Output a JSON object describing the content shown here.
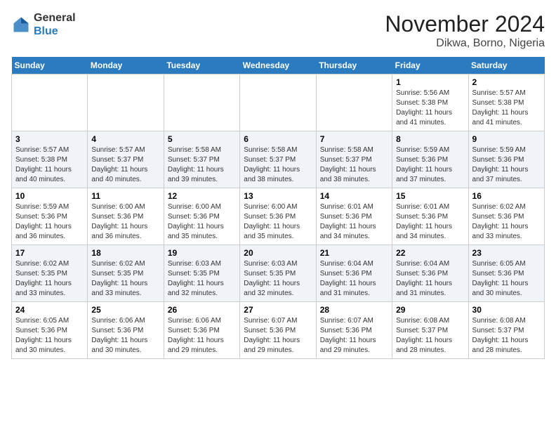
{
  "header": {
    "logo": {
      "general": "General",
      "blue": "Blue"
    },
    "title": "November 2024",
    "location": "Dikwa, Borno, Nigeria"
  },
  "calendar": {
    "days_of_week": [
      "Sunday",
      "Monday",
      "Tuesday",
      "Wednesday",
      "Thursday",
      "Friday",
      "Saturday"
    ],
    "weeks": [
      [
        {
          "day": "",
          "info": ""
        },
        {
          "day": "",
          "info": ""
        },
        {
          "day": "",
          "info": ""
        },
        {
          "day": "",
          "info": ""
        },
        {
          "day": "",
          "info": ""
        },
        {
          "day": "1",
          "info": "Sunrise: 5:56 AM\nSunset: 5:38 PM\nDaylight: 11 hours and 41 minutes."
        },
        {
          "day": "2",
          "info": "Sunrise: 5:57 AM\nSunset: 5:38 PM\nDaylight: 11 hours and 41 minutes."
        }
      ],
      [
        {
          "day": "3",
          "info": "Sunrise: 5:57 AM\nSunset: 5:38 PM\nDaylight: 11 hours and 40 minutes."
        },
        {
          "day": "4",
          "info": "Sunrise: 5:57 AM\nSunset: 5:37 PM\nDaylight: 11 hours and 40 minutes."
        },
        {
          "day": "5",
          "info": "Sunrise: 5:58 AM\nSunset: 5:37 PM\nDaylight: 11 hours and 39 minutes."
        },
        {
          "day": "6",
          "info": "Sunrise: 5:58 AM\nSunset: 5:37 PM\nDaylight: 11 hours and 38 minutes."
        },
        {
          "day": "7",
          "info": "Sunrise: 5:58 AM\nSunset: 5:37 PM\nDaylight: 11 hours and 38 minutes."
        },
        {
          "day": "8",
          "info": "Sunrise: 5:59 AM\nSunset: 5:36 PM\nDaylight: 11 hours and 37 minutes."
        },
        {
          "day": "9",
          "info": "Sunrise: 5:59 AM\nSunset: 5:36 PM\nDaylight: 11 hours and 37 minutes."
        }
      ],
      [
        {
          "day": "10",
          "info": "Sunrise: 5:59 AM\nSunset: 5:36 PM\nDaylight: 11 hours and 36 minutes."
        },
        {
          "day": "11",
          "info": "Sunrise: 6:00 AM\nSunset: 5:36 PM\nDaylight: 11 hours and 36 minutes."
        },
        {
          "day": "12",
          "info": "Sunrise: 6:00 AM\nSunset: 5:36 PM\nDaylight: 11 hours and 35 minutes."
        },
        {
          "day": "13",
          "info": "Sunrise: 6:00 AM\nSunset: 5:36 PM\nDaylight: 11 hours and 35 minutes."
        },
        {
          "day": "14",
          "info": "Sunrise: 6:01 AM\nSunset: 5:36 PM\nDaylight: 11 hours and 34 minutes."
        },
        {
          "day": "15",
          "info": "Sunrise: 6:01 AM\nSunset: 5:36 PM\nDaylight: 11 hours and 34 minutes."
        },
        {
          "day": "16",
          "info": "Sunrise: 6:02 AM\nSunset: 5:36 PM\nDaylight: 11 hours and 33 minutes."
        }
      ],
      [
        {
          "day": "17",
          "info": "Sunrise: 6:02 AM\nSunset: 5:35 PM\nDaylight: 11 hours and 33 minutes."
        },
        {
          "day": "18",
          "info": "Sunrise: 6:02 AM\nSunset: 5:35 PM\nDaylight: 11 hours and 33 minutes."
        },
        {
          "day": "19",
          "info": "Sunrise: 6:03 AM\nSunset: 5:35 PM\nDaylight: 11 hours and 32 minutes."
        },
        {
          "day": "20",
          "info": "Sunrise: 6:03 AM\nSunset: 5:35 PM\nDaylight: 11 hours and 32 minutes."
        },
        {
          "day": "21",
          "info": "Sunrise: 6:04 AM\nSunset: 5:36 PM\nDaylight: 11 hours and 31 minutes."
        },
        {
          "day": "22",
          "info": "Sunrise: 6:04 AM\nSunset: 5:36 PM\nDaylight: 11 hours and 31 minutes."
        },
        {
          "day": "23",
          "info": "Sunrise: 6:05 AM\nSunset: 5:36 PM\nDaylight: 11 hours and 30 minutes."
        }
      ],
      [
        {
          "day": "24",
          "info": "Sunrise: 6:05 AM\nSunset: 5:36 PM\nDaylight: 11 hours and 30 minutes."
        },
        {
          "day": "25",
          "info": "Sunrise: 6:06 AM\nSunset: 5:36 PM\nDaylight: 11 hours and 30 minutes."
        },
        {
          "day": "26",
          "info": "Sunrise: 6:06 AM\nSunset: 5:36 PM\nDaylight: 11 hours and 29 minutes."
        },
        {
          "day": "27",
          "info": "Sunrise: 6:07 AM\nSunset: 5:36 PM\nDaylight: 11 hours and 29 minutes."
        },
        {
          "day": "28",
          "info": "Sunrise: 6:07 AM\nSunset: 5:36 PM\nDaylight: 11 hours and 29 minutes."
        },
        {
          "day": "29",
          "info": "Sunrise: 6:08 AM\nSunset: 5:37 PM\nDaylight: 11 hours and 28 minutes."
        },
        {
          "day": "30",
          "info": "Sunrise: 6:08 AM\nSunset: 5:37 PM\nDaylight: 11 hours and 28 minutes."
        }
      ]
    ]
  }
}
